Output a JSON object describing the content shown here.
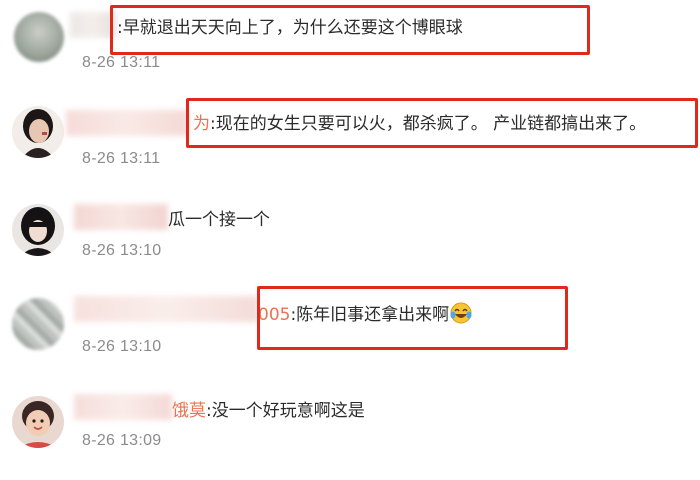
{
  "comments": [
    {
      "username": "",
      "separator": ":",
      "text": "早就退出天天向上了，为什么还要这个博眼球",
      "time": "8-26 13:11",
      "highlighted": true
    },
    {
      "username": "为",
      "separator": ":",
      "text": "现在的女生只要可以火，都杀疯了。 产业链都搞出来了。",
      "time": "8-26 13:11",
      "highlighted": true
    },
    {
      "username": "",
      "separator": "",
      "text": "瓜一个接一个",
      "time": "8-26 13:10",
      "highlighted": false
    },
    {
      "username": "005",
      "separator": ":",
      "text": "陈年旧事还拿出来啊",
      "time": "8-26 13:10",
      "highlighted": true,
      "emoji": "laughing-crying-emoji-icon"
    },
    {
      "username": "饿莫",
      "separator": ":",
      "text": "没一个好玩意啊这是",
      "time": "8-26 13:09",
      "highlighted": false
    }
  ],
  "colors": {
    "highlight_border": "#e0281b",
    "username": "#eb7350",
    "time": "#8c8c8c",
    "text": "#2b2b2b"
  }
}
